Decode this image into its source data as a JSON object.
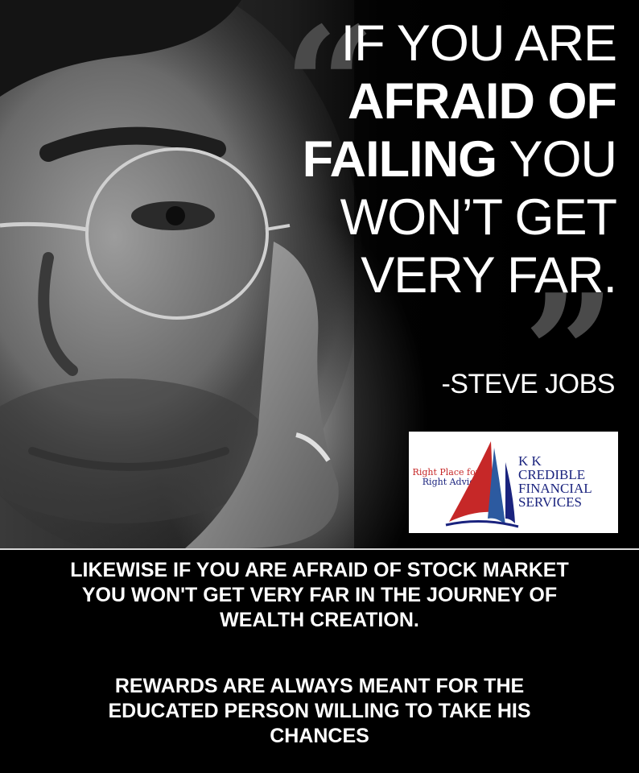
{
  "quote": {
    "lines": [
      {
        "parts": [
          "IF YOU ARE"
        ]
      },
      {
        "bold": "AFRAID OF"
      },
      {
        "bold": "FAILING",
        "thin": " YOU"
      },
      {
        "parts": [
          "WON’T GET"
        ]
      },
      {
        "parts": [
          "VERY FAR."
        ]
      }
    ],
    "line1": "IF YOU ARE",
    "line2": "AFRAID OF",
    "line3_bold": "FAILING",
    "line3_thin": " YOU",
    "line4": "WON’T GET",
    "line5": "VERY FAR.",
    "open_mark": "“",
    "close_mark": "”",
    "author": "-STEVE JOBS"
  },
  "logo": {
    "tagline_1": "Right Place for",
    "tagline_2": "Right Advice",
    "brand_1": "K K",
    "brand_2": "CREDIBLE",
    "brand_3": "FINANCIAL",
    "brand_4": "SERVICES",
    "colors": {
      "red": "#c62828",
      "navy": "#1a237e",
      "blue": "#2c5aa0"
    }
  },
  "message": {
    "p1_l1": "LIKEWISE IF YOU ARE AFRAID OF STOCK MARKET",
    "p1_l2": "YOU WON'T GET VERY FAR IN THE JOURNEY OF",
    "p1_l3": "WEALTH CREATION.",
    "p2_l1": "REWARDS ARE ALWAYS MEANT FOR THE",
    "p2_l2": "EDUCATED PERSON WILLING TO TAKE HIS",
    "p2_l3": "CHANCES"
  }
}
